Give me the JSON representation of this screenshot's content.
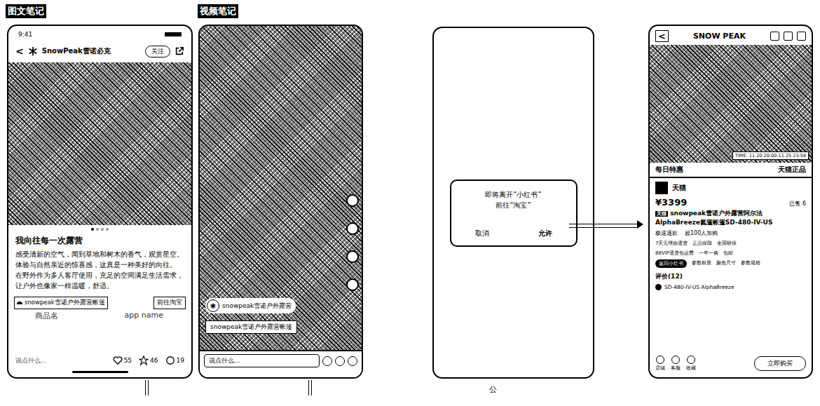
{
  "labels": {
    "image_note": "图文笔记",
    "video_note": "视频笔记",
    "product_name": "商品名",
    "app_name": "app name",
    "footer_mark": "公"
  },
  "image_note": {
    "time": "9:41",
    "back": "<",
    "author": "SnowPeak雪诺必克",
    "follow": "关注",
    "title": "我向往每一次露营",
    "body": [
      "感受清新的空气，闻到草地和树木的香气，观赏星空。体验与自然亲近的惊喜感，这真是一种美好的向往。",
      "在野外作为多人客厅使用，充足的空间满足生活需求，让户外也像家一样温暖，舒适。"
    ],
    "page_dots": [
      {
        "selected": true
      },
      {
        "selected": false
      },
      {
        "selected": false
      },
      {
        "selected": false
      }
    ],
    "product_tag": "snowpeak雪诺户外露营帐篷",
    "app_link": "前往淘宝",
    "comment_placeholder": "说点什么...",
    "likes": "55",
    "stars": "46",
    "comments": "19"
  },
  "video_note": {
    "author": "snowpeak雪诺户外露营",
    "product_tag": "snowpeak雪诺户外露营帐篷",
    "comment_placeholder": "说点什么..."
  },
  "dialog": {
    "message": [
      "即将离开“小红书”",
      "前往“淘宝”"
    ],
    "buttons": [
      {
        "label": "取消",
        "primary": false
      },
      {
        "label": "允许",
        "primary": true
      }
    ]
  },
  "product": {
    "store_name": "SNOW PEAK",
    "time": "TIME: 11.20 20:00-11.25 23:59",
    "promo": "每日特惠",
    "promo_right": "天猫正品",
    "shop": "天猫",
    "price": "¥3399",
    "sold": "已售 6",
    "badge": "天猫",
    "title": "snowpeak雪诺户外露营阿尔法AlphaBreeze氮篷帐篷SD-480-IV-US",
    "tags": [
      "极速退款",
      "超100人加购"
    ],
    "services": [
      "7天无理由退货",
      "正品保障",
      "全国联保"
    ],
    "delivery": [
      "88VIP退货包运费",
      "一年一换",
      "包邮"
    ],
    "back_to_app": "返回小红书",
    "extras": [
      "参数材质",
      "颜色尺寸",
      "参数规格"
    ],
    "reviews": "评价(12)",
    "review_snippet": "SD-480-IV-US AlphaBreeze",
    "tabbar": [
      "店铺",
      "客服",
      "收藏"
    ],
    "buy": "立即购买"
  }
}
